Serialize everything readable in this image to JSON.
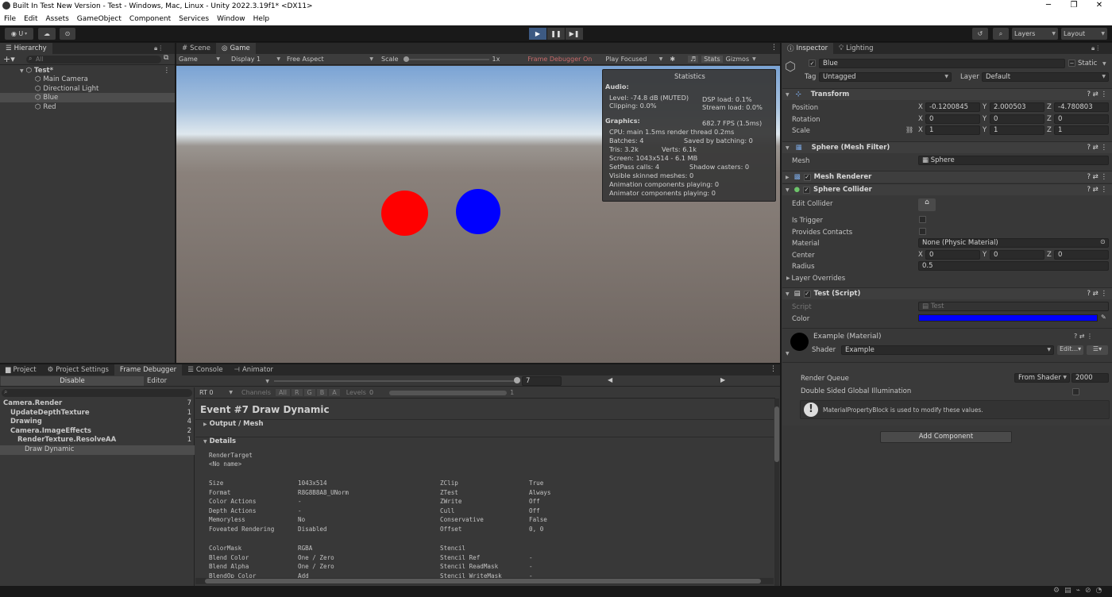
{
  "window": {
    "title": "Built In Test New Version - Test - Windows, Mac, Linux - Unity 2022.3.19f1* <DX11>"
  },
  "menu": [
    "File",
    "Edit",
    "Assets",
    "GameObject",
    "Component",
    "Services",
    "Window",
    "Help"
  ],
  "toolbar": {
    "account": "U",
    "layers": "Layers",
    "layout": "Layout"
  },
  "hierarchy": {
    "tab": "Hierarchy",
    "search_placeholder": "All",
    "scene": "Test*",
    "items": [
      "Main Camera",
      "Directional Light",
      "Blue",
      "Red"
    ],
    "selected": "Blue"
  },
  "view_tabs": {
    "scene": "Scene",
    "game": "Game"
  },
  "game_bar": {
    "mode": "Game",
    "display": "Display 1",
    "aspect": "Free Aspect",
    "scale_label": "Scale",
    "scale_value": "1x",
    "frame_debugger": "Frame Debugger On",
    "play_mode": "Play Focused",
    "stats": "Stats",
    "gizmos": "Gizmos"
  },
  "colors": {
    "red_sphere": "#ff0000",
    "blue_sphere": "#0000ff",
    "accent": "#3d5a83"
  },
  "statistics": {
    "title": "Statistics",
    "audio_header": "Audio:",
    "level": "Level: -74.8 dB (MUTED)",
    "dsp": "DSP load: 0.1%",
    "clipping": "Clipping: 0.0%",
    "stream": "Stream load: 0.0%",
    "graphics_header": "Graphics:",
    "fps": "682.7 FPS (1.5ms)",
    "cpu": "CPU: main 1.5ms  render thread 0.2ms",
    "batches": "Batches: 4",
    "saved": "Saved by batching: 0",
    "tris": "Tris: 3.2k",
    "verts": "Verts: 6.1k",
    "screen": "Screen: 1043x514 - 6.1 MB",
    "setpass": "SetPass calls: 4",
    "shadow": "Shadow casters: 0",
    "skinned": "Visible skinned meshes: 0",
    "anim": "Animation components playing: 0",
    "animator": "Animator components playing: 0"
  },
  "bottom_tabs": [
    "Project",
    "Project Settings",
    "Frame Debugger",
    "Console",
    "Animator"
  ],
  "frame_debugger": {
    "disable": "Disable",
    "editor": "Editor",
    "event_number": "7",
    "rt": "RT 0",
    "channels": "Channels",
    "channel_btns": [
      "All",
      "R",
      "G",
      "B",
      "A"
    ],
    "levels": "Levels",
    "levels_value": "0",
    "levels_max": "1",
    "tree": [
      {
        "label": "Camera.Render",
        "count": "7",
        "indent": 0,
        "bold": true
      },
      {
        "label": "UpdateDepthTexture",
        "count": "1",
        "indent": 1,
        "bold": true
      },
      {
        "label": "Drawing",
        "count": "4",
        "indent": 1,
        "bold": true
      },
      {
        "label": "Camera.ImageEffects",
        "count": "2",
        "indent": 1,
        "bold": true
      },
      {
        "label": "RenderTexture.ResolveAA",
        "count": "1",
        "indent": 2,
        "bold": true
      },
      {
        "label": "Draw Dynamic",
        "count": "",
        "indent": 3,
        "bold": false
      }
    ],
    "event_title": "Event #7 Draw Dynamic",
    "output_mesh": "Output / Mesh",
    "details": "Details",
    "render_target_label": "RenderTarget",
    "render_target_value": "<No name>",
    "left_props": [
      [
        "Size",
        "1043x514"
      ],
      [
        "Format",
        "R8G8B8A8_UNorm"
      ],
      [
        "Color Actions",
        "-"
      ],
      [
        "Depth Actions",
        "-"
      ],
      [
        "Memoryless",
        "No"
      ],
      [
        "Foveated Rendering",
        "Disabled"
      ]
    ],
    "right_props": [
      [
        "ZClip",
        "True"
      ],
      [
        "ZTest",
        "Always"
      ],
      [
        "ZWrite",
        "Off"
      ],
      [
        "Cull",
        "Off"
      ],
      [
        "Conservative",
        "False"
      ],
      [
        "Offset",
        "0, 0"
      ]
    ],
    "left_props2": [
      [
        "ColorMask",
        "RGBA"
      ],
      [
        "Blend Color",
        "One / Zero"
      ],
      [
        "Blend Alpha",
        "One / Zero"
      ],
      [
        "BlendOp Color",
        "Add"
      ]
    ],
    "right_props2": [
      [
        "Stencil",
        ""
      ],
      [
        "Stencil Ref",
        "-"
      ],
      [
        "Stencil ReadMask",
        "-"
      ],
      [
        "Stencil WriteMask",
        "-"
      ]
    ]
  },
  "inspector": {
    "tab": "Inspector",
    "lighting_tab": "Lighting",
    "object_name": "Blue",
    "static": "Static",
    "tag_label": "Tag",
    "tag": "Untagged",
    "layer_label": "Layer",
    "layer": "Default",
    "transform": {
      "title": "Transform",
      "position": {
        "label": "Position",
        "x": "-0.1200845",
        "y": "2.000503",
        "z": "-4.780803"
      },
      "rotation": {
        "label": "Rotation",
        "x": "0",
        "y": "0",
        "z": "0"
      },
      "scale": {
        "label": "Scale",
        "x": "1",
        "y": "1",
        "z": "1"
      }
    },
    "mesh_filter": {
      "title": "Sphere (Mesh Filter)",
      "mesh_label": "Mesh",
      "mesh": "Sphere"
    },
    "mesh_renderer": {
      "title": "Mesh Renderer"
    },
    "sphere_collider": {
      "title": "Sphere Collider",
      "edit_collider": "Edit Collider",
      "is_trigger": "Is Trigger",
      "provides_contacts": "Provides Contacts",
      "material_label": "Material",
      "material": "None (Physic Material)",
      "center_label": "Center",
      "cx": "0",
      "cy": "0",
      "cz": "0",
      "radius_label": "Radius",
      "radius": "0.5",
      "layer_overrides": "Layer Overrides"
    },
    "test_script": {
      "title": "Test (Script)",
      "script_label": "Script",
      "script": "Test",
      "color_label": "Color",
      "color": "#0000ff"
    },
    "material": {
      "name": "Example (Material)",
      "shader_label": "Shader",
      "shader": "Example",
      "edit": "Edit...",
      "render_queue_label": "Render Queue",
      "render_queue_src": "From Shader",
      "render_queue": "2000",
      "double_sided": "Double Sided Global Illumination",
      "info": "MaterialPropertyBlock is used to modify these values."
    },
    "add_component": "Add Component"
  }
}
